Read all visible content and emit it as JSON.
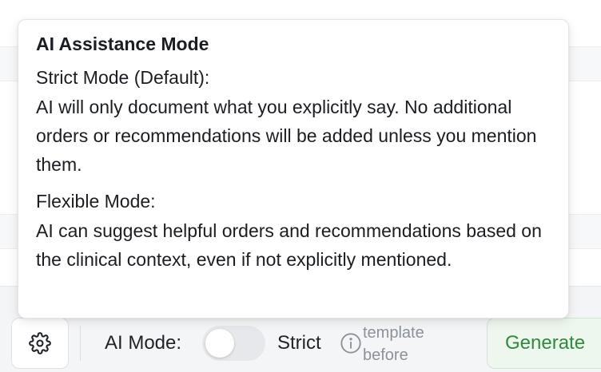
{
  "tooltip": {
    "title": "AI Assistance Mode",
    "strict_heading": "Strict Mode (Default):",
    "strict_text": "AI will only document what you explicitly say. No additional orders or recommendations will be added unless you mention them.",
    "flexible_heading": "Flexible Mode:",
    "flexible_text": "AI can suggest helpful orders and recommendations based on the clinical context, even if not explicitly mentioned."
  },
  "toolbar": {
    "settings_icon": "gear-icon",
    "ai_mode_label": "AI Mode:",
    "toggle_state": "off",
    "mode_value": "Strict",
    "info_icon": "info-icon",
    "hint_text": "template before",
    "generate_label": "Generate"
  },
  "colors": {
    "generate_text": "#2f8a3c",
    "generate_bg": "#eef7ee",
    "toggle_track": "#e6e8eb"
  }
}
